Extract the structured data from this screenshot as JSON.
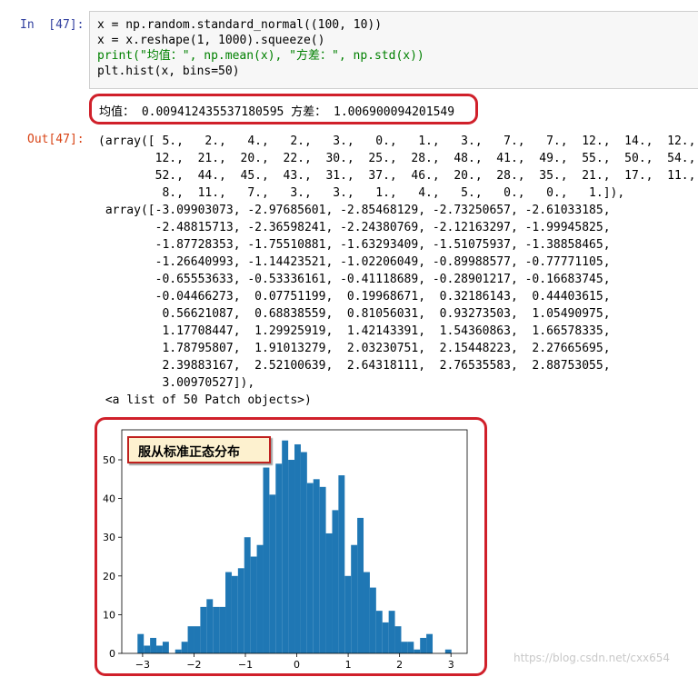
{
  "in_prompt": "In  [47]:",
  "out_prompt": "Out[47]:",
  "code_lines": [
    "x = np.random.standard_normal((100, 10))",
    "x = x.reshape(1, 1000).squeeze()",
    "print(\"均值：\", np.mean(x), \"方差：\", np.std(x))",
    "plt.hist(x, bins=50)"
  ],
  "stdout": "均值： 0.009412435537180595 方差： 1.006900094201549",
  "output_lines": [
    "(array([ 5.,   2.,   4.,   2.,   3.,   0.,   1.,   3.,   7.,   7.,  12.,  14.,  12.,",
    "        12.,  21.,  20.,  22.,  30.,  25.,  28.,  48.,  41.,  49.,  55.,  50.,  54.,",
    "        52.,  44.,  45.,  43.,  31.,  37.,  46.,  20.,  28.,  35.,  21.,  17.,  11.,",
    "         8.,  11.,   7.,   3.,   3.,   1.,   4.,   5.,   0.,   0.,   1.]),",
    " array([-3.09903073, -2.97685601, -2.85468129, -2.73250657, -2.61033185,",
    "        -2.48815713, -2.36598241, -2.24380769, -2.12163297, -1.99945825,",
    "        -1.87728353, -1.75510881, -1.63293409, -1.51075937, -1.38858465,",
    "        -1.26640993, -1.14423521, -1.02206049, -0.89988577, -0.77771105,",
    "        -0.65553633, -0.53336161, -0.41118689, -0.28901217, -0.16683745,",
    "        -0.04466273,  0.07751199,  0.19968671,  0.32186143,  0.44403615,",
    "         0.56621087,  0.68838559,  0.81056031,  0.93273503,  1.05490975,",
    "         1.17708447,  1.29925919,  1.42143391,  1.54360863,  1.66578335,",
    "         1.78795807,  1.91013279,  2.03230751,  2.15448223,  2.27665695,",
    "         2.39883167,  2.52100639,  2.64318111,  2.76535583,  2.88753055,",
    "         3.00970527]),",
    " <a list of 50 Patch objects>)"
  ],
  "chart_title_annotation": "服从标准正态分布",
  "watermark": "https://blog.csdn.net/cxx654",
  "colors": {
    "bar": "#1f77b4",
    "highlight_border": "#d0202a",
    "annotation_bg": "#fdf1cf"
  },
  "chart_data": {
    "type": "bar",
    "counts": [
      5,
      2,
      4,
      2,
      3,
      0,
      1,
      3,
      7,
      7,
      12,
      14,
      12,
      12,
      21,
      20,
      22,
      30,
      25,
      28,
      48,
      41,
      49,
      55,
      50,
      54,
      52,
      44,
      45,
      43,
      31,
      37,
      46,
      20,
      28,
      35,
      21,
      17,
      11,
      8,
      11,
      7,
      3,
      3,
      1,
      4,
      5,
      0,
      0,
      1
    ],
    "bin_start": -3.09903073,
    "bin_end": 3.00970527,
    "xticks": [
      -3,
      -2,
      -1,
      0,
      1,
      2,
      3
    ],
    "yticks": [
      0,
      10,
      20,
      30,
      40,
      50
    ],
    "xlim": [
      -3.405,
      3.315
    ],
    "ylim": [
      0,
      57.75
    ]
  }
}
